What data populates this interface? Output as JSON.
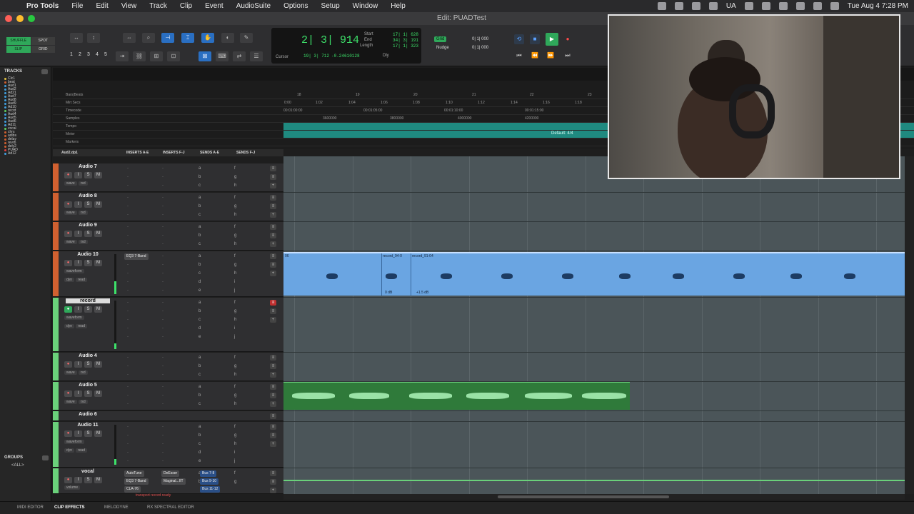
{
  "menubar": {
    "app": "Pro Tools",
    "items": [
      "File",
      "Edit",
      "View",
      "Track",
      "Clip",
      "Event",
      "AudioSuite",
      "Options",
      "Setup",
      "Window",
      "Help"
    ],
    "status_ua": "UA",
    "clock": "Tue Aug 4  7:28 PM"
  },
  "window": {
    "title": "Edit: PUADTest"
  },
  "toolbar": {
    "modes": [
      "SHUFFLE",
      "SPOT",
      "SLIP",
      "GRID"
    ],
    "zoom_presets": [
      "1",
      "2",
      "3",
      "4",
      "5"
    ]
  },
  "counter": {
    "main": "2| 3| 914",
    "start_label": "Start",
    "end_label": "End",
    "length_label": "Length",
    "start": "17| 1| 628",
    "end": "34| 3| 191",
    "length": "17| 1| 323",
    "cursor_label": "Cursor",
    "cursor_value": "19| 3| 712",
    "cursor_extra": "-0.24610128",
    "dly_label": "Dly",
    "grid_label": "Grid",
    "nudge_label": "Nudge",
    "grid_value": "0| 1| 000",
    "nudge_value": "0| 1| 000"
  },
  "tracks_panel": {
    "title": "TRACKS",
    "items": [
      {
        "name": "Clc1",
        "color": "#e0c040"
      },
      {
        "name": "beat",
        "color": "#d06030"
      },
      {
        "name": "Aud1",
        "color": "#40a0e0"
      },
      {
        "name": "Aud2",
        "color": "#40a0e0"
      },
      {
        "name": "Ad21",
        "color": "#40a0e0"
      },
      {
        "name": "Aud7",
        "color": "#40a0e0"
      },
      {
        "name": "Aud8",
        "color": "#40a0e0"
      },
      {
        "name": "Aud9",
        "color": "#40a0e0"
      },
      {
        "name": "Ad10",
        "color": "#40a0e0"
      },
      {
        "name": "recrd",
        "color": "#60d060"
      },
      {
        "name": "Aud4",
        "color": "#40a0e0"
      },
      {
        "name": "Aud5",
        "color": "#40a0e0"
      },
      {
        "name": "Aud6",
        "color": "#40a0e0"
      },
      {
        "name": "Ad11",
        "color": "#40a0e0"
      },
      {
        "name": "vocal",
        "color": "#60d060"
      },
      {
        "name": "chrs",
        "color": "#d06030"
      },
      {
        "name": "adlbs",
        "color": "#d06030"
      },
      {
        "name": "delay",
        "color": "#d06030"
      },
      {
        "name": "revrb",
        "color": "#d06030"
      },
      {
        "name": "dely2",
        "color": "#d06030"
      },
      {
        "name": "PUAD",
        "color": "#e04040"
      },
      {
        "name": "Ad12",
        "color": "#40a0e0"
      }
    ]
  },
  "groups_panel": {
    "title": "GROUPS",
    "all": "<ALL>"
  },
  "rulers": {
    "labels": [
      "Bars|Beats",
      "Min:Secs",
      "Timecode",
      "Samples",
      "Tempo",
      "Meter",
      "Markers"
    ],
    "bars_ticks": [
      "18",
      "19",
      "20",
      "21",
      "22",
      "23"
    ],
    "minsecs_ticks": [
      "0:00",
      "1:02",
      "1:04",
      "1:06",
      "1:08",
      "1:10",
      "1:12",
      "1:14",
      "1:16",
      "1:18"
    ],
    "timecode_ticks": [
      "00:01:00:00",
      "00:01:05:00",
      "00:01:10:00",
      "00:01:15:00"
    ],
    "samples_ticks": [
      "3600000",
      "3800000",
      "4000000",
      "4200000"
    ],
    "meter_default": "Default: 4/4"
  },
  "columns": {
    "first_track": "Aud2.dp1",
    "inserts_ae": "INSERTS A-E",
    "inserts_fj": "INSERTS F-J",
    "sends_ae": "SENDS A-E",
    "sends_fj": "SENDS F-J"
  },
  "tracks": [
    {
      "name": "Audio 7",
      "view": "wave",
      "vol": "rsd"
    },
    {
      "name": "Audio 8",
      "view": "wave",
      "vol": "rsd"
    },
    {
      "name": "Audio 9",
      "view": "wave",
      "vol": "rsd"
    },
    {
      "name": "Audio 10",
      "view": "waveform",
      "dyn": "dyn",
      "vol": "read",
      "insert": "EQ3 7-Band"
    },
    {
      "name": "record",
      "view": "waveform",
      "dyn": "dyn",
      "vol": "read"
    },
    {
      "name": "Audio 4",
      "view": "wave",
      "vol": "rsd"
    },
    {
      "name": "Audio 5",
      "view": "wave",
      "vol": "rsd"
    },
    {
      "name": "Audio 6"
    },
    {
      "name": "Audio 11",
      "view": "waveform",
      "dyn": "dyn",
      "vol": "read"
    },
    {
      "name": "vocal",
      "view": "volume",
      "ins1": "AutoTune",
      "ins2": "EQ3 7-Band",
      "ins3": "CLA-76",
      "ins4": "DeEsser",
      "ins5": "Maginal...IIT",
      "send1": "Bus 7-8",
      "send2": "Bus 9-10",
      "send3": "Bus 11-12"
    }
  ],
  "slot_letters": {
    "a": "a",
    "b": "b",
    "c": "c",
    "d": "d",
    "e": "e",
    "f": "f",
    "g": "g",
    "h": "h",
    "i": "i",
    "j": "j"
  },
  "clips": {
    "c1": "record_94-0",
    "c2": "record_91-04",
    "gain1": "0 dB",
    "gain2": "+1.5 dB",
    "num": "06"
  },
  "status": {
    "transport": "transport record ready"
  },
  "bottom_tabs": [
    "MIDI EDITOR",
    "CLIP EFFECTS",
    "MELODYNE",
    "RX SPECTRAL EDITOR"
  ],
  "colors": {
    "accent_green": "#3de26a",
    "clip_blue": "#6aa5e2",
    "clip_green": "#2f7a3a",
    "tempo": "#1f8a80"
  }
}
